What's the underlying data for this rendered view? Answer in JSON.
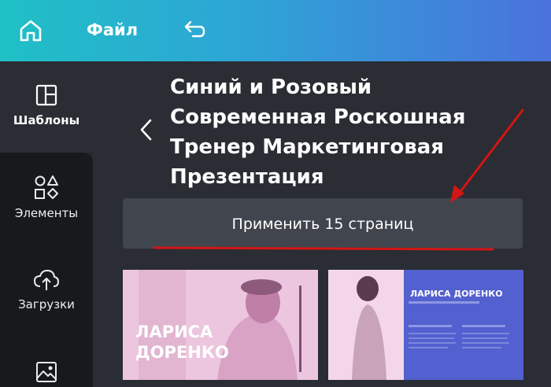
{
  "topbar": {
    "home_icon": "home-icon",
    "file_label": "Файл",
    "undo_icon": "undo-icon"
  },
  "sidebar": {
    "items": [
      {
        "label": "Шаблоны",
        "icon": "templates-icon",
        "active": true
      },
      {
        "label": "Элементы",
        "icon": "shapes-icon",
        "active": false
      },
      {
        "label": "Загрузки",
        "icon": "cloud-upload-icon",
        "active": false
      },
      {
        "label": "",
        "icon": "image-icon",
        "active": false
      }
    ]
  },
  "template": {
    "title_lines": [
      "Синий и Розовый",
      "Современная Роскошная",
      "Тренер Маркетинговая",
      "Презентация"
    ],
    "apply_label": "Применить 15 страниц"
  },
  "thumbnails": [
    {
      "name_lines": [
        "ЛАРИСА",
        "ДОРЕНКО"
      ],
      "background": "#e9c3dc"
    },
    {
      "name_lines": [
        "ЛАРИСА ДОРЕНКО"
      ],
      "background": "#5360cf"
    }
  ],
  "colors": {
    "annotation_red": "#d31515",
    "panel": "#2a2d33",
    "button": "#41454d"
  }
}
